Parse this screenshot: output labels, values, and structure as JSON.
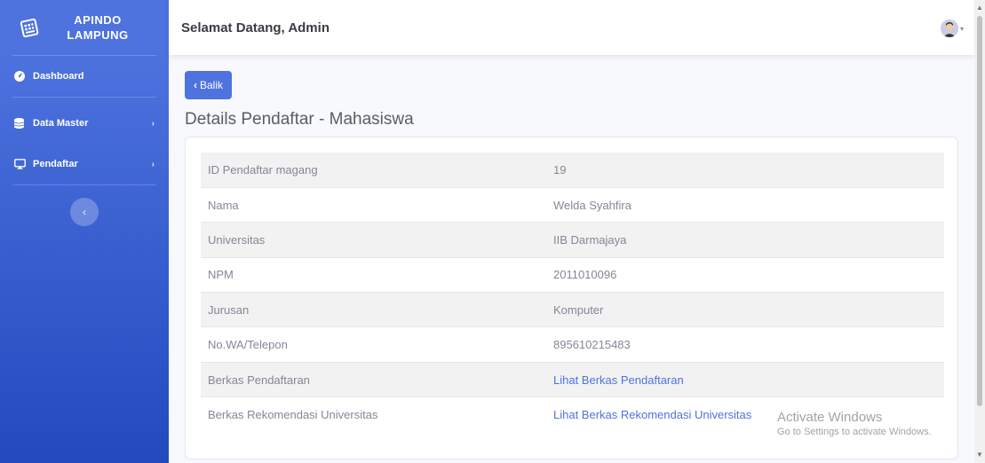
{
  "sidebar": {
    "brand_line1": "APINDO",
    "brand_line2": "LAMPUNG",
    "brand_icon": "keyboard-icon",
    "items": [
      {
        "label": "Dashboard",
        "icon": "tachometer-icon"
      },
      {
        "label": "Data Master",
        "icon": "database-icon"
      },
      {
        "label": "Pendaftar",
        "icon": "desktop-icon"
      }
    ],
    "toggle_glyph": "‹"
  },
  "topbar": {
    "welcome": "Selamat Datang, Admin",
    "avatar_icon": "user-avatar-icon"
  },
  "content": {
    "back_label": "Balik",
    "title": "Details Pendaftar - Mahasiswa",
    "rows": [
      {
        "label": "ID Pendaftar magang",
        "value": "19"
      },
      {
        "label": "Nama",
        "value": "Welda Syahfira"
      },
      {
        "label": "Universitas",
        "value": "IIB Darmajaya"
      },
      {
        "label": "NPM",
        "value": "2011010096"
      },
      {
        "label": "Jurusan",
        "value": "Komputer"
      },
      {
        "label": "No.WA/Telepon",
        "value": "895610215483"
      },
      {
        "label": "Berkas Pendaftaran",
        "value": "Lihat Berkas Pendaftaran"
      },
      {
        "label": "Berkas Rekomendasi Universitas",
        "value": "Lihat Berkas Rekomendasi Universitas"
      }
    ]
  },
  "watermark": {
    "line1": "Activate Windows",
    "line2": "Go to Settings to activate Windows."
  },
  "colors": {
    "primary": "#4e73df",
    "sidebar_bottom": "#224abe",
    "text_muted": "#858796"
  }
}
